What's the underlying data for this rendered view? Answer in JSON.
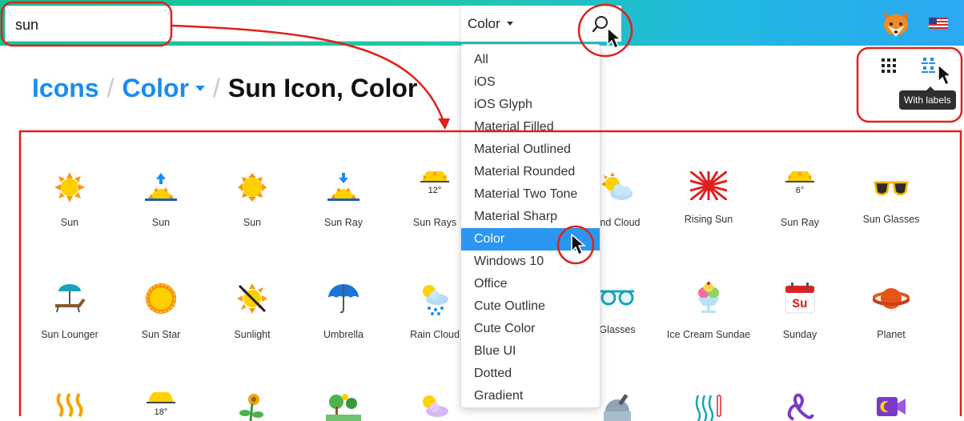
{
  "search": {
    "value": "sun",
    "placeholder": ""
  },
  "style_select": {
    "selected": "Color"
  },
  "breadcrumb": {
    "root": "Icons",
    "category": "Color",
    "current": "Sun Icon, Color",
    "separator": "/"
  },
  "view_toggle": {
    "tooltip": "With labels"
  },
  "dropdown": {
    "items": [
      "All",
      "iOS",
      "iOS Glyph",
      "Material Filled",
      "Material Outlined",
      "Material Rounded",
      "Material Two Tone",
      "Material Sharp",
      "Color",
      "Windows 10",
      "Office",
      "Cute Outline",
      "Cute Color",
      "Blue UI",
      "Dotted",
      "Gradient"
    ],
    "active_index": 8
  },
  "icon_glyph_text": {
    "sun_rays_temp": "12°",
    "sun_ray_temp": "6°",
    "sunday": "Su",
    "row3_temp": "18°"
  },
  "icons_row1": [
    "Sun",
    "Sun",
    "Sun",
    "Sun Ray",
    "Sun Rays",
    "",
    "and Cloud",
    "Rising Sun",
    "Sun Ray",
    "Sun Glasses"
  ],
  "icons_row2": [
    "Sun Lounger",
    "Sun Star",
    "Sunlight",
    "Umbrella",
    "Rain Cloud",
    "",
    "Glasses",
    "Ice Cream Sundae",
    "Sunday",
    "Planet"
  ],
  "colors": {
    "accent": "#1a8cf0",
    "highlight": "#2b96f1",
    "annotation": "#e0201b",
    "sun": "#ffd000",
    "sun_ray": "#f59a12"
  }
}
